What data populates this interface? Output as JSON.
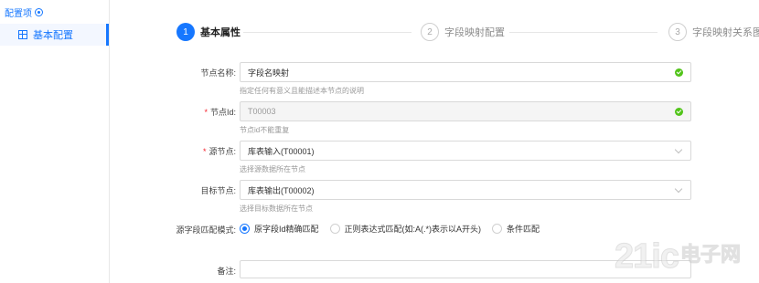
{
  "sidebar": {
    "header": "配置项",
    "header_icon": "target-icon",
    "items": [
      {
        "label": "基本配置",
        "icon": "grid-icon",
        "active": true
      }
    ]
  },
  "steps": [
    {
      "number": "1",
      "label": "基本属性",
      "state": "active"
    },
    {
      "number": "2",
      "label": "字段映射配置",
      "state": "pending"
    },
    {
      "number": "3",
      "label": "字段映射关系图",
      "state": "pending"
    }
  ],
  "form": {
    "node_name": {
      "label": "节点名称:",
      "value": "字段名映射",
      "help": "指定任何有意义且能描述本节点的说明",
      "status_icon": "check-icon"
    },
    "node_id": {
      "label": "节点Id:",
      "required": "*",
      "value": "T00003",
      "help": "节点id不能重复",
      "status_icon": "check-icon",
      "disabled": true
    },
    "source_node": {
      "label": "源节点:",
      "required": "*",
      "value": "库表输入(T00001)",
      "help": "选择源数据所在节点",
      "icon": "chevron-down-icon"
    },
    "target_node": {
      "label": "目标节点:",
      "value": "库表输出(T00002)",
      "help": "选择目标数据所在节点",
      "icon": "chevron-down-icon"
    },
    "match_mode": {
      "label": "源字段匹配模式:",
      "options": [
        {
          "label": "原字段Id精确匹配",
          "checked": true
        },
        {
          "label": "正则表达式匹配(如:A(.*)表示以A开头)",
          "checked": false
        },
        {
          "label": "条件匹配",
          "checked": false
        }
      ]
    },
    "remark": {
      "label": "备注:",
      "value": ""
    }
  },
  "watermark": {
    "text": "21ic",
    "cn": "电子网"
  },
  "colors": {
    "primary": "#1677ff",
    "success": "#52c41a",
    "required": "#f5222d"
  }
}
